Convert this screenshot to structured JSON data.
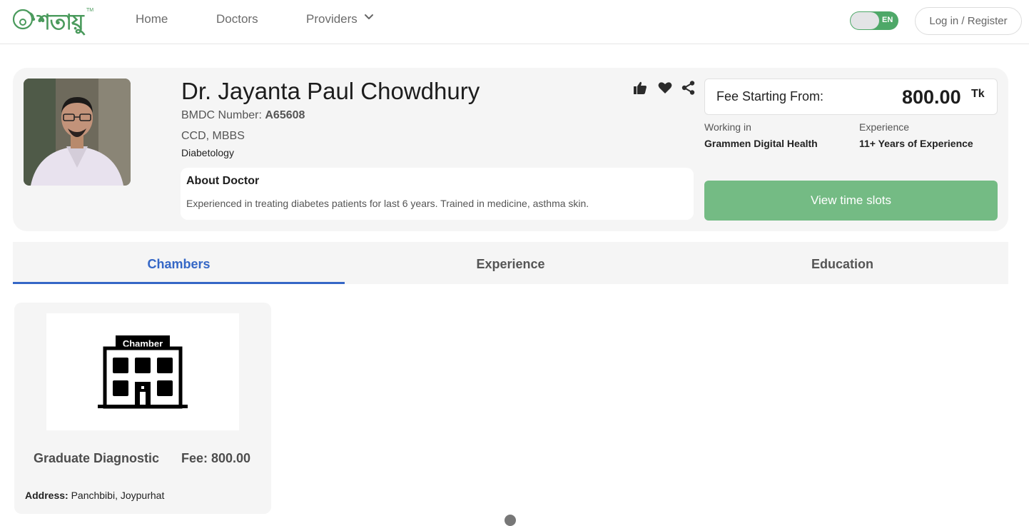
{
  "header": {
    "logo_text": "শতায়ু",
    "logo_tm": "TM",
    "nav": [
      {
        "label": "Home"
      },
      {
        "label": "Doctors"
      },
      {
        "label": "Providers"
      }
    ],
    "language_toggle": "EN",
    "login_label": "Log in / Register"
  },
  "doctor": {
    "name": "Dr. Jayanta Paul Chowdhury",
    "bmdc_label": "BMDC Number:",
    "bmdc_number": "A65608",
    "degrees": "CCD, MBBS",
    "speciality": "Diabetology",
    "about_title": "About Doctor",
    "about_text": "Experienced in treating diabetes patients for last 6 years. Trained in medicine, asthma skin."
  },
  "fee_panel": {
    "label": "Fee Starting From:",
    "value": "800.00",
    "currency": "Tk",
    "working_label": "Working in",
    "working_value": "Grammen Digital Health",
    "experience_label": "Experience",
    "experience_value": "11+ Years of Experience",
    "slots_button": "View time slots"
  },
  "tabs": [
    {
      "label": "Chambers",
      "active": true
    },
    {
      "label": "Experience",
      "active": false
    },
    {
      "label": "Education",
      "active": false
    }
  ],
  "chamber": {
    "image_label": "Chamber",
    "name": "Graduate Diagnostic",
    "fee": "Fee: 800.00",
    "address_label": "Address:",
    "address": "Panchbibi, Joypurhat"
  },
  "colors": {
    "brand_green": "#4a9a5c",
    "button_green": "#74bb84",
    "tab_active": "#3567c6"
  }
}
